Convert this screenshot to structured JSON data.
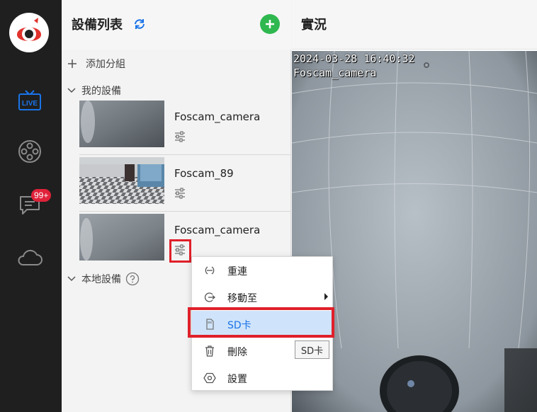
{
  "rail": {
    "live_label": "LIVE",
    "message_badge": "99+"
  },
  "device_panel": {
    "title": "設備列表",
    "add_group": "添加分組",
    "my_devices": "我的設備",
    "local_devices": "本地設備",
    "devices": [
      {
        "name": "Foscam_camera"
      },
      {
        "name": "Foscam_89"
      },
      {
        "name": "Foscam_camera"
      }
    ]
  },
  "live_panel": {
    "title": "實況",
    "osd_time": "2024-03-28 16:40:32",
    "osd_name": "Foscam_camera"
  },
  "context_menu": {
    "items": [
      {
        "label": "重連",
        "icon": "reconnect-icon"
      },
      {
        "label": "移動至",
        "icon": "move-icon"
      },
      {
        "label": "SD卡",
        "icon": "sd-card-icon"
      },
      {
        "label": "刪除",
        "icon": "trash-icon"
      },
      {
        "label": "設置",
        "icon": "settings-icon"
      }
    ],
    "selected_index": 2
  },
  "tooltip": "SD卡",
  "colors": {
    "rail_bg": "#1f1f1f",
    "accent_blue": "#1a73e8",
    "add_green": "#2fb84f",
    "highlight_red": "#e0202a",
    "selected_bg": "#cfe4fb"
  }
}
